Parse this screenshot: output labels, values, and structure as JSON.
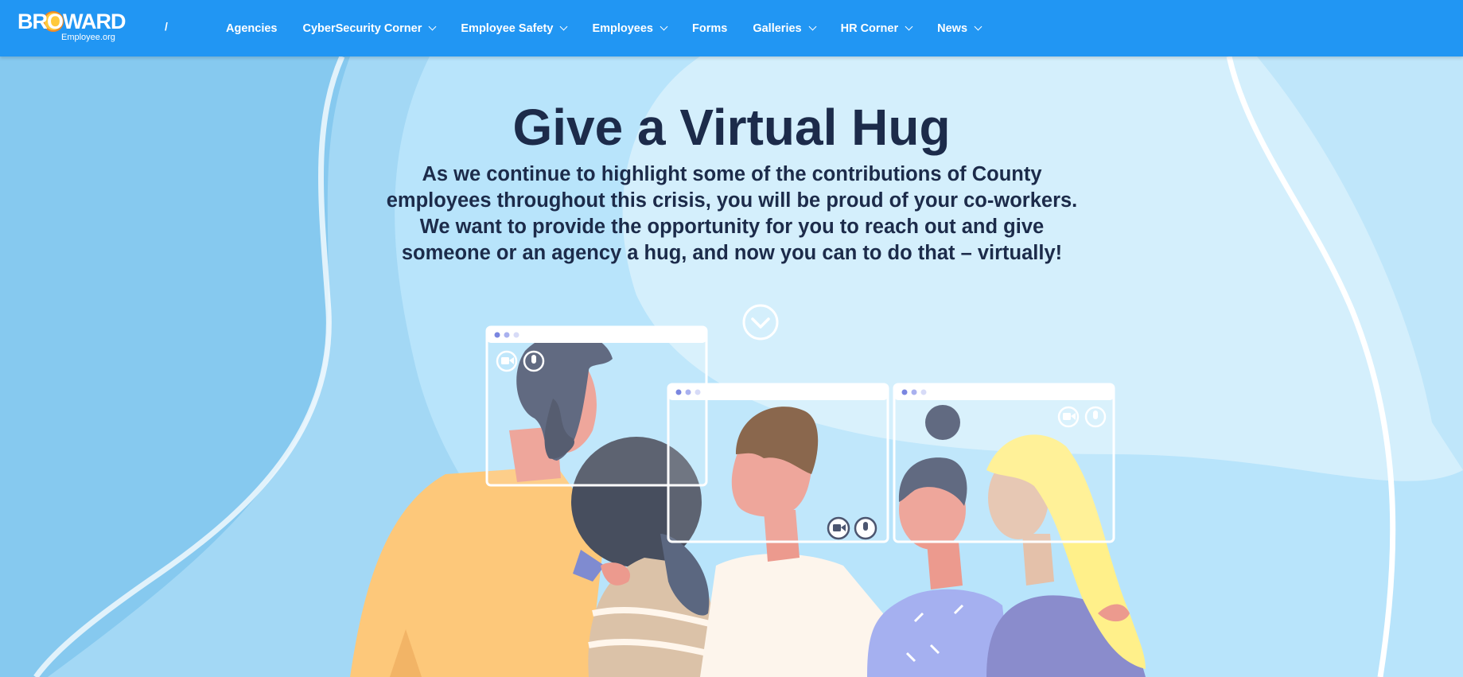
{
  "logo": {
    "main": "BROWARD",
    "sub": "Employee.org"
  },
  "nav": {
    "separator": "/",
    "items": [
      {
        "label": "Agencies",
        "dropdown": false
      },
      {
        "label": "CyberSecurity Corner",
        "dropdown": true
      },
      {
        "label": "Employee Safety",
        "dropdown": true
      },
      {
        "label": "Employees",
        "dropdown": true
      },
      {
        "label": "Forms",
        "dropdown": false
      },
      {
        "label": "Galleries",
        "dropdown": true
      },
      {
        "label": "HR Corner",
        "dropdown": true
      },
      {
        "label": "News",
        "dropdown": true
      }
    ]
  },
  "hero": {
    "title": "Give a Virtual Hug",
    "subtitle": "As we continue to highlight some of the contributions of County employees throughout this crisis, you will be proud of your co-workers. We want to provide the opportunity for you to reach out and give someone or an agency a hug, and now you can to do that – virtually!",
    "scroll_icon": "chevron-down-circle-icon"
  },
  "colors": {
    "nav_bg": "#2196f3",
    "hero_bg": "#86c9ef",
    "title_text": "#1c2b4a"
  }
}
